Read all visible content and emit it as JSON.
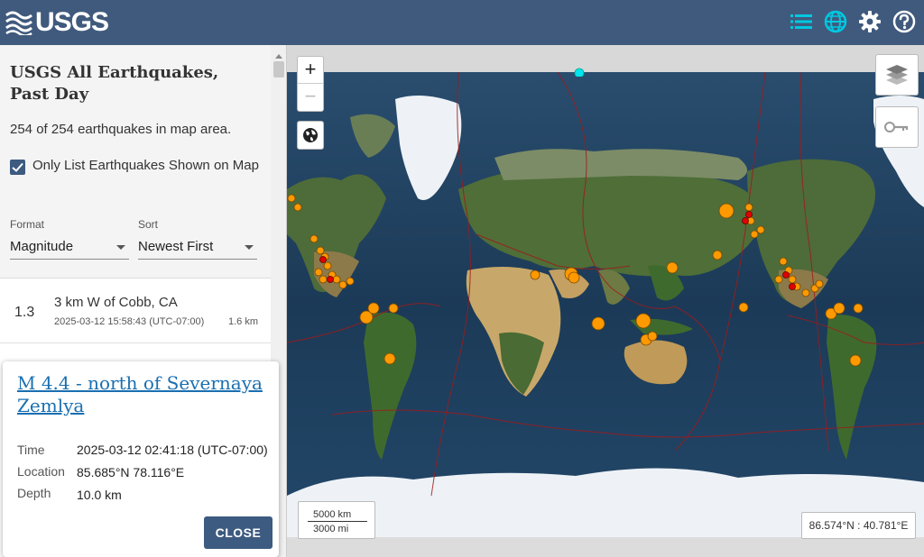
{
  "header": {
    "logo_text": "USGS",
    "icons": [
      "list-icon",
      "globe-icon",
      "gear-icon",
      "help-icon"
    ]
  },
  "sidebar": {
    "title": "USGS All Earthquakes, Past Day",
    "count_text": "254 of 254 earthquakes in map area.",
    "only_list_label": "Only List Earthquakes Shown on Map",
    "only_list_checked": true,
    "format_label": "Format",
    "format_value": "Magnitude",
    "sort_label": "Sort",
    "sort_value": "Newest First",
    "earthquakes": [
      {
        "mag": "1.3",
        "place": "3 km W of Cobb, CA",
        "time": "2025-03-12 15:58:43 (UTC-07:00)",
        "depth": "1.6 km"
      }
    ]
  },
  "popup": {
    "title": "M 4.4 - north of Severnaya Zemlya",
    "time_label": "Time",
    "time_value": "2025-03-12 02:41:18 (UTC-07:00)",
    "location_label": "Location",
    "location_value": "85.685°N 78.116°E",
    "depth_label": "Depth",
    "depth_value": "10.0 km",
    "close_label": "CLOSE"
  },
  "map": {
    "zoom_in": "+",
    "zoom_out": "−",
    "scale_km": "5000 km",
    "scale_mi": "3000 mi",
    "coords": "86.574°N : 40.781°E",
    "colors": {
      "ocean": "#1f3f5c",
      "quake_orange": "#ff9900",
      "quake_red": "#e00000",
      "plate_boundary": "#a01a1a"
    }
  }
}
